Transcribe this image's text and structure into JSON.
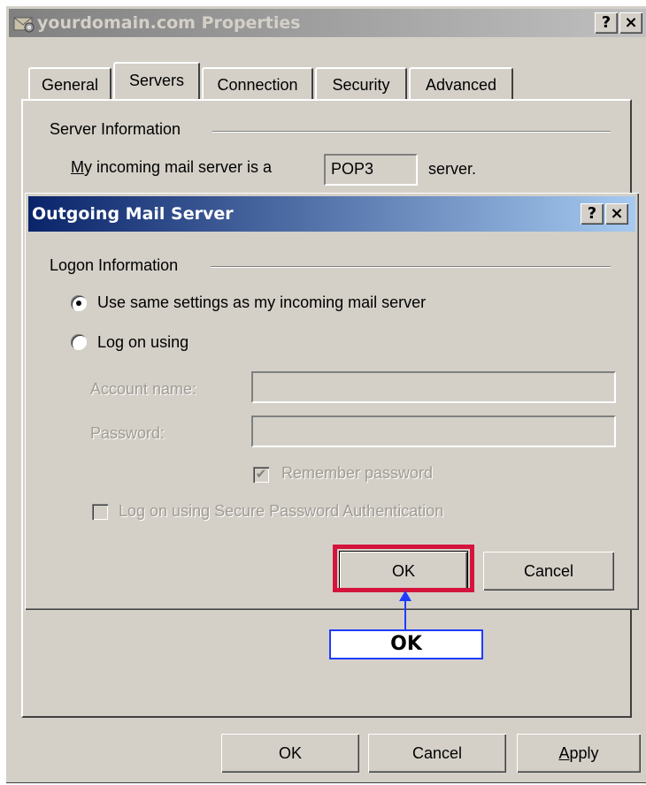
{
  "window": {
    "title": "yourdomain.com Properties",
    "help_button": "?",
    "close_button": "×"
  },
  "tabs": [
    {
      "label": "General",
      "active": false
    },
    {
      "label": "Servers",
      "active": true
    },
    {
      "label": "Connection",
      "active": false
    },
    {
      "label": "Security",
      "active": false
    },
    {
      "label": "Advanced",
      "active": false
    }
  ],
  "servers": {
    "group_label": "Server Information",
    "incoming_label_prefix": "M",
    "incoming_label_rest": "y incoming mail server is a",
    "incoming_value": "POP3",
    "incoming_suffix": "server."
  },
  "outgoing_dialog": {
    "title": "Outgoing Mail Server",
    "help_button": "?",
    "close_button": "×",
    "group_label": "Logon Information",
    "radio_same": "Use same settings as my incoming mail server",
    "radio_logon": "Log on using",
    "account_label": "Account name:",
    "account_value": "",
    "password_label": "Password:",
    "password_value": "",
    "remember_label": "Remember password",
    "remember_checked": true,
    "spa_label": "Log on using Secure Password Authentication",
    "spa_checked": false,
    "ok": "OK",
    "cancel": "Cancel"
  },
  "annotation": {
    "callout": "OK",
    "highlight_color": "#d4143c",
    "arrow_color": "#1e3cff"
  },
  "footer": {
    "ok": "OK",
    "cancel": "Cancel",
    "apply_prefix": "A",
    "apply_rest": "pply"
  }
}
